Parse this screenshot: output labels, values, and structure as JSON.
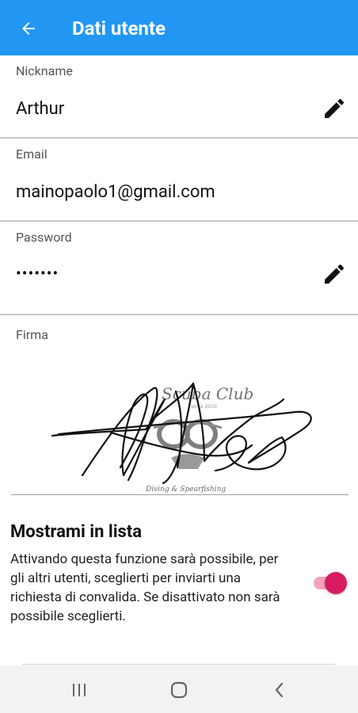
{
  "appbar": {
    "title": "Dati utente",
    "color": "#2196f3",
    "back_icon": "arrow-left-icon"
  },
  "fields": {
    "nickname": {
      "label": "Nickname",
      "value": "Arthur",
      "edit_icon": "pencil-icon"
    },
    "email": {
      "label": "Email",
      "value": "mainopaolo1@gmail.com"
    },
    "password": {
      "label": "Password",
      "value": "•••••••",
      "edit_icon": "pencil-icon"
    }
  },
  "signature": {
    "label": "Firma",
    "logo_text": "Scuba Club",
    "logo_subtext": "since 2010",
    "logo_tagline": "Diving & Spearfishing"
  },
  "list_toggle": {
    "title": "Mostrami in lista",
    "description": "Attivando questa funzione sarà possibile, per gli altri utenti, sceglierti per inviarti una richiesta di convalida. Se disattivato non sarà possibile sceglierti.",
    "enabled": true,
    "accent": "#d81b60"
  },
  "navbar": {
    "icons": [
      "recent-apps-icon",
      "home-icon",
      "back-icon"
    ]
  }
}
